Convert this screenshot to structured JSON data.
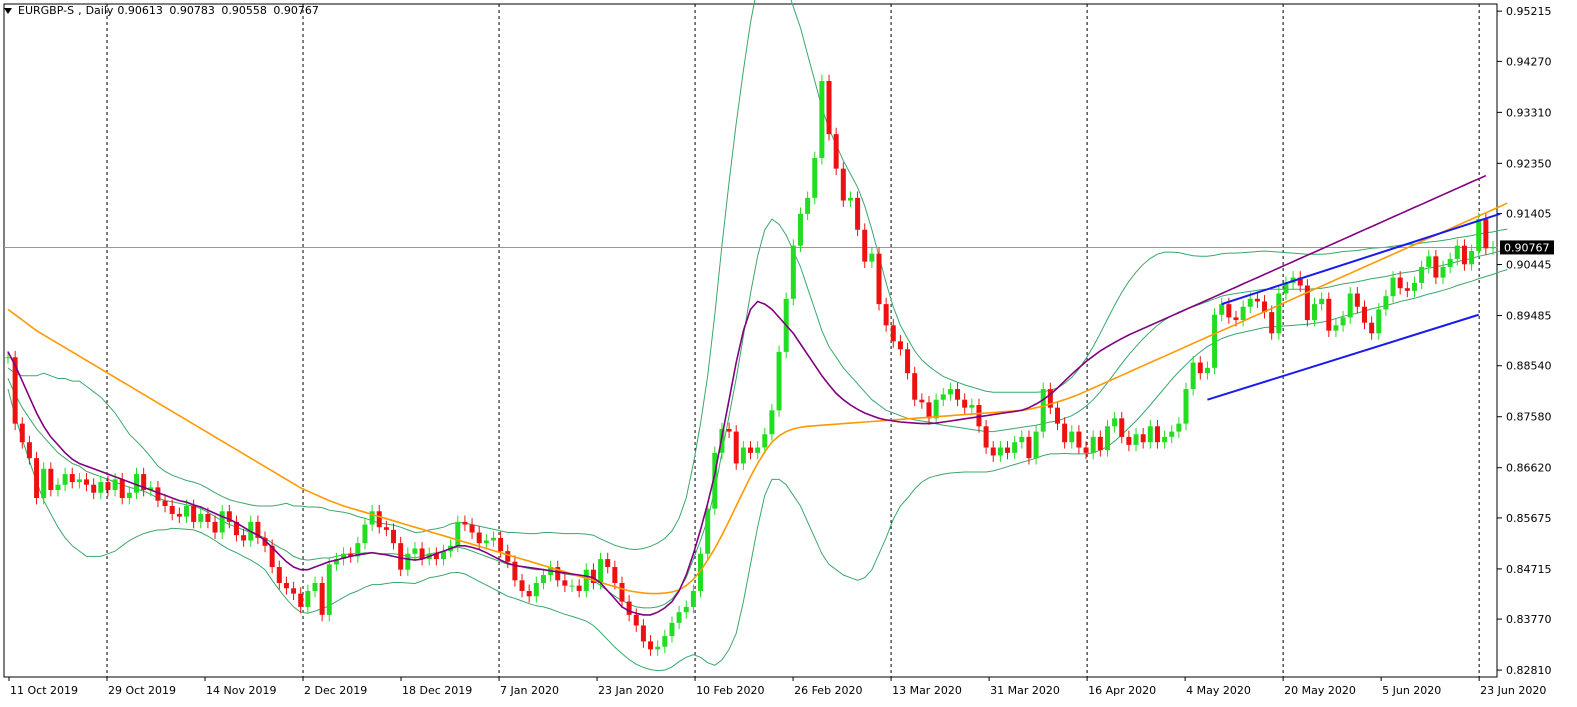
{
  "header": {
    "symbol": "EURGBP-S",
    "timeframe": "Daily",
    "open": "0.90613",
    "high": "0.90783",
    "low": "0.90558",
    "close": "0.90767"
  },
  "current_price_label": "0.90767",
  "colors": {
    "bull_candle": "#22dd22",
    "bear_candle": "#ee1111",
    "ma_fast": "#800080",
    "ma_slow": "#ff9900",
    "bollinger": "#3aa86a",
    "channel": "#1a1aee",
    "grid_line": "#000000",
    "price_line": "#999999"
  },
  "chart_data": {
    "type": "candlestick",
    "title": "EURGBP-S,Daily",
    "yaxis_ticks": [
      "0.95215",
      "0.94270",
      "0.93310",
      "0.92350",
      "0.91405",
      "0.90445",
      "0.89485",
      "0.88540",
      "0.87580",
      "0.86620",
      "0.85675",
      "0.84715",
      "0.83770",
      "0.82810"
    ],
    "ylim": [
      0.8268,
      0.9535
    ],
    "xaxis_ticks": [
      "11 Oct 2019",
      "29 Oct 2019",
      "14 Nov 2019",
      "2 Dec 2019",
      "18 Dec 2019",
      "7 Jan 2020",
      "23 Jan 2020",
      "10 Feb 2020",
      "26 Feb 2020",
      "13 Mar 2020",
      "31 Mar 2020",
      "16 Apr 2020",
      "4 May 2020",
      "20 May 2020",
      "5 Jun 2020",
      "23 Jun 2020"
    ],
    "vertical_separators_at": [
      "29 Oct 2019",
      "2 Dec 2019",
      "7 Jan 2020",
      "10 Feb 2020",
      "13 Mar 2020",
      "16 Apr 2020",
      "20 May 2020",
      "23 Jun 2020"
    ],
    "current_price": 0.90767,
    "close_series": [
      0.887,
      0.8745,
      0.871,
      0.868,
      0.8605,
      0.866,
      0.862,
      0.863,
      0.865,
      0.8635,
      0.864,
      0.863,
      0.8615,
      0.8635,
      0.862,
      0.864,
      0.8605,
      0.8615,
      0.865,
      0.862,
      0.8625,
      0.86,
      0.859,
      0.8575,
      0.857,
      0.859,
      0.856,
      0.8575,
      0.856,
      0.854,
      0.858,
      0.856,
      0.8535,
      0.8525,
      0.856,
      0.853,
      0.8515,
      0.8475,
      0.8445,
      0.8435,
      0.8425,
      0.84,
      0.843,
      0.8445,
      0.8385,
      0.848,
      0.849,
      0.85,
      0.8495,
      0.852,
      0.8555,
      0.858,
      0.855,
      0.8545,
      0.852,
      0.847,
      0.85,
      0.851,
      0.849,
      0.85,
      0.849,
      0.8505,
      0.8515,
      0.856,
      0.8555,
      0.854,
      0.852,
      0.8525,
      0.853,
      0.8505,
      0.8485,
      0.845,
      0.843,
      0.842,
      0.8445,
      0.846,
      0.8475,
      0.845,
      0.844,
      0.844,
      0.843,
      0.847,
      0.8445,
      0.849,
      0.8475,
      0.8445,
      0.841,
      0.8385,
      0.8365,
      0.8335,
      0.832,
      0.8325,
      0.8345,
      0.837,
      0.839,
      0.84,
      0.843,
      0.85,
      0.8585,
      0.869,
      0.8735,
      0.873,
      0.867,
      0.87,
      0.869,
      0.87,
      0.8725,
      0.877,
      0.888,
      0.898,
      0.908,
      0.914,
      0.917,
      0.9245,
      0.939,
      0.929,
      0.9225,
      0.9165,
      0.917,
      0.911,
      0.905,
      0.9065,
      0.897,
      0.893,
      0.89,
      0.8885,
      0.884,
      0.879,
      0.8785,
      0.8755,
      0.879,
      0.88,
      0.881,
      0.879,
      0.8775,
      0.878,
      0.874,
      0.87,
      0.8685,
      0.87,
      0.869,
      0.871,
      0.872,
      0.868,
      0.873,
      0.881,
      0.8775,
      0.8745,
      0.871,
      0.873,
      0.87,
      0.869,
      0.872,
      0.8695,
      0.874,
      0.8755,
      0.872,
      0.8705,
      0.8725,
      0.871,
      0.874,
      0.871,
      0.872,
      0.873,
      0.8745,
      0.881,
      0.886,
      0.884,
      0.885,
      0.895,
      0.897,
      0.8945,
      0.894,
      0.8965,
      0.898,
      0.8975,
      0.8955,
      0.8915,
      0.899,
      0.901,
      0.902,
      0.9005,
      0.894,
      0.897,
      0.898,
      0.892,
      0.893,
      0.8945,
      0.899,
      0.8965,
      0.8935,
      0.8915,
      0.896,
      0.8985,
      0.902,
      0.9,
      0.8995,
      0.901,
      0.904,
      0.906,
      0.902,
      0.904,
      0.9055,
      0.908,
      0.9045,
      0.907,
      0.913,
      0.9075,
      0.9077
    ],
    "bollinger_mid": [
      0.883,
      0.88,
      0.8775,
      0.8755,
      0.8735,
      0.872,
      0.8705,
      0.869,
      0.868,
      0.867,
      0.8665,
      0.8655,
      0.865,
      0.8645,
      0.864,
      0.8635,
      0.863,
      0.8625,
      0.8622,
      0.8618,
      0.8612,
      0.8605,
      0.86,
      0.8598,
      0.8595,
      0.8592,
      0.859,
      0.8585,
      0.8578,
      0.857,
      0.8562,
      0.8555,
      0.855,
      0.8545,
      0.854,
      0.8535,
      0.853,
      0.852,
      0.8512,
      0.8505,
      0.8495,
      0.849,
      0.8488,
      0.849,
      0.8492,
      0.8492,
      0.8495,
      0.8498,
      0.85,
      0.85,
      0.8502,
      0.8502,
      0.85,
      0.85,
      0.85,
      0.8498,
      0.8495,
      0.8492,
      0.8495,
      0.85,
      0.8502,
      0.8505,
      0.851,
      0.8512,
      0.851,
      0.8505,
      0.85,
      0.8495,
      0.849,
      0.8485,
      0.848,
      0.8478,
      0.8475,
      0.8472,
      0.847,
      0.847,
      0.8468,
      0.8465,
      0.8462,
      0.846,
      0.8458,
      0.8455,
      0.845,
      0.844,
      0.843,
      0.842,
      0.8412,
      0.8405,
      0.84,
      0.8398,
      0.8398,
      0.84,
      0.8405,
      0.8415,
      0.8432,
      0.8455,
      0.849,
      0.8525,
      0.8565,
      0.862,
      0.869,
      0.876,
      0.883,
      0.891,
      0.899,
      0.906,
      0.911,
      0.913,
      0.912,
      0.91,
      0.907,
      0.904,
      0.9,
      0.896,
      0.892,
      0.889,
      0.887,
      0.885,
      0.8835,
      0.882,
      0.8805,
      0.879,
      0.878,
      0.877,
      0.8765,
      0.876,
      0.8755,
      0.8752,
      0.875,
      0.8748,
      0.8745,
      0.8742,
      0.874,
      0.8738,
      0.8736,
      0.8734,
      0.8732,
      0.873,
      0.873,
      0.8732,
      0.8734,
      0.8736,
      0.8738,
      0.874,
      0.8742,
      0.8745,
      0.8748,
      0.875,
      0.8755,
      0.876,
      0.8768,
      0.8778,
      0.879,
      0.8805,
      0.8822,
      0.884,
      0.8858,
      0.8875,
      0.889,
      0.8905,
      0.8918,
      0.893,
      0.894,
      0.8948,
      0.8955,
      0.896,
      0.8965,
      0.897,
      0.8975,
      0.898,
      0.8985,
      0.8988,
      0.899,
      0.8992,
      0.8994,
      0.8996,
      0.8998,
      0.8998,
      0.8998,
      0.8998,
      0.8998,
      0.8998,
      0.8998,
      0.8999,
      0.9,
      0.9002,
      0.9005,
      0.9008,
      0.901,
      0.9012,
      0.9015,
      0.9018,
      0.902,
      0.9022,
      0.9025,
      0.9028,
      0.903,
      0.9032,
      0.9035,
      0.9038,
      0.904,
      0.9043,
      0.9046,
      0.905,
      0.9053,
      0.9056,
      0.906,
      0.9063,
      0.9066,
      0.907,
      0.9073,
      0.9076,
      0.908
    ],
    "bollinger_width": [
      0.002,
      0.004,
      0.006,
      0.008,
      0.01,
      0.012,
      0.013,
      0.014,
      0.015,
      0.0155,
      0.016,
      0.016,
      0.0155,
      0.015,
      0.014,
      0.013,
      0.0115,
      0.01,
      0.009,
      0.008,
      0.007,
      0.006,
      0.0055,
      0.005,
      0.0048,
      0.0046,
      0.0045,
      0.0045,
      0.0045,
      0.0045,
      0.0046,
      0.0047,
      0.0048,
      0.005,
      0.0052,
      0.0055,
      0.006,
      0.007,
      0.008,
      0.009,
      0.0095,
      0.01,
      0.01,
      0.0098,
      0.0095,
      0.009,
      0.0085,
      0.008,
      0.0075,
      0.007,
      0.0065,
      0.006,
      0.0058,
      0.0056,
      0.0054,
      0.0052,
      0.005,
      0.0048,
      0.0046,
      0.0045,
      0.0045,
      0.0045,
      0.0046,
      0.0047,
      0.0048,
      0.005,
      0.0052,
      0.0054,
      0.0056,
      0.0058,
      0.006,
      0.0062,
      0.0064,
      0.0066,
      0.0068,
      0.007,
      0.0072,
      0.0074,
      0.0076,
      0.0078,
      0.008,
      0.0082,
      0.0085,
      0.0088,
      0.0092,
      0.0096,
      0.01,
      0.0104,
      0.0108,
      0.0112,
      0.0116,
      0.012,
      0.0124,
      0.0128,
      0.0135,
      0.015,
      0.018,
      0.022,
      0.027,
      0.033,
      0.039,
      0.044,
      0.048,
      0.05,
      0.051,
      0.051,
      0.05,
      0.049,
      0.048,
      0.047,
      0.046,
      0.045,
      0.044,
      0.043,
      0.042,
      0.041,
      0.04,
      0.039,
      0.038,
      0.037,
      0.035,
      0.032,
      0.028,
      0.024,
      0.02,
      0.017,
      0.015,
      0.013,
      0.0115,
      0.0105,
      0.0098,
      0.0092,
      0.0088,
      0.0085,
      0.0082,
      0.008,
      0.0078,
      0.0076,
      0.0074,
      0.0072,
      0.007,
      0.0068,
      0.0066,
      0.0064,
      0.0062,
      0.006,
      0.006,
      0.0062,
      0.0066,
      0.0072,
      0.008,
      0.009,
      0.01,
      0.011,
      0.012,
      0.0128,
      0.0134,
      0.0138,
      0.014,
      0.014,
      0.0138,
      0.0134,
      0.0128,
      0.012,
      0.0112,
      0.0104,
      0.0096,
      0.009,
      0.0085,
      0.0082,
      0.008,
      0.0078,
      0.0076,
      0.0075,
      0.0074,
      0.0073,
      0.0072,
      0.0071,
      0.007,
      0.0069,
      0.0068,
      0.0067,
      0.0066,
      0.0065,
      0.0064,
      0.0063,
      0.0062,
      0.0061,
      0.006,
      0.0059,
      0.0058,
      0.0057,
      0.0056,
      0.0055,
      0.0054,
      0.0053,
      0.0052,
      0.0051,
      0.005,
      0.0049,
      0.0048,
      0.0047,
      0.0046,
      0.0045,
      0.0044,
      0.0043,
      0.0042,
      0.0041,
      0.004,
      0.0039,
      0.0038
    ],
    "ma_fast": [
      0.888,
      0.8855,
      0.8825,
      0.8795,
      0.8765,
      0.874,
      0.872,
      0.8705,
      0.869,
      0.8678,
      0.867,
      0.8665,
      0.866,
      0.8655,
      0.865,
      0.8645,
      0.864,
      0.8635,
      0.863,
      0.8625,
      0.862,
      0.8615,
      0.861,
      0.8605,
      0.86,
      0.8597,
      0.8592,
      0.8588,
      0.8582,
      0.8576,
      0.857,
      0.8565,
      0.8558,
      0.855,
      0.8542,
      0.8535,
      0.8525,
      0.8512,
      0.8498,
      0.8485,
      0.8475,
      0.847,
      0.847,
      0.8475,
      0.848,
      0.8485,
      0.8488,
      0.8492,
      0.8495,
      0.8498,
      0.85,
      0.8502,
      0.85,
      0.8498,
      0.8495,
      0.8492,
      0.849,
      0.8488,
      0.849,
      0.8495,
      0.85,
      0.8505,
      0.851,
      0.8515,
      0.8515,
      0.8512,
      0.8508,
      0.8502,
      0.8495,
      0.8488,
      0.8482,
      0.8478,
      0.8476,
      0.8474,
      0.8472,
      0.847,
      0.8468,
      0.8466,
      0.8464,
      0.8462,
      0.846,
      0.8458,
      0.8455,
      0.8445,
      0.843,
      0.8415,
      0.84,
      0.8392,
      0.8388,
      0.8385,
      0.8385,
      0.839,
      0.8398,
      0.841,
      0.843,
      0.846,
      0.85,
      0.8545,
      0.8595,
      0.865,
      0.872,
      0.879,
      0.886,
      0.892,
      0.896,
      0.8975,
      0.897,
      0.896,
      0.8945,
      0.893,
      0.8915,
      0.8895,
      0.8875,
      0.8855,
      0.8835,
      0.8818,
      0.8802,
      0.879,
      0.878,
      0.8772,
      0.8765,
      0.876,
      0.8755,
      0.8752,
      0.875,
      0.8748,
      0.8747,
      0.8746,
      0.8745,
      0.8745,
      0.8746,
      0.8748,
      0.875,
      0.8752,
      0.8754,
      0.8756,
      0.8758,
      0.876,
      0.8762,
      0.8764,
      0.8766,
      0.8768,
      0.877,
      0.8775,
      0.8782,
      0.879,
      0.88,
      0.8812,
      0.8825,
      0.8838,
      0.885,
      0.8862,
      0.8872,
      0.8882,
      0.889,
      0.8898,
      0.8905,
      0.8912,
      0.8918,
      0.8924,
      0.893,
      0.8936,
      0.8942,
      0.8948,
      0.8954,
      0.896,
      0.8966,
      0.8972,
      0.8978,
      0.8984,
      0.899,
      0.8996,
      0.9002,
      0.9008,
      0.9014,
      0.902,
      0.9026,
      0.9032,
      0.9038,
      0.9044,
      0.905,
      0.9056,
      0.9062,
      0.9068,
      0.9074,
      0.908,
      0.9086,
      0.9092,
      0.9098,
      0.9104,
      0.911,
      0.9116,
      0.9122,
      0.9128,
      0.9134,
      0.914,
      0.9146,
      0.9152,
      0.9158,
      0.9164,
      0.917,
      0.9176,
      0.9182,
      0.9188,
      0.9194,
      0.92,
      0.9206,
      0.9212
    ],
    "ma_slow": [
      0.896,
      0.895,
      0.894,
      0.893,
      0.892,
      0.8912,
      0.8904,
      0.8896,
      0.8888,
      0.888,
      0.8872,
      0.8864,
      0.8856,
      0.8848,
      0.884,
      0.8832,
      0.8824,
      0.8816,
      0.8808,
      0.88,
      0.8792,
      0.8784,
      0.8776,
      0.8768,
      0.876,
      0.8752,
      0.8744,
      0.8736,
      0.8728,
      0.872,
      0.8712,
      0.8704,
      0.8696,
      0.8688,
      0.868,
      0.8672,
      0.8664,
      0.8656,
      0.8648,
      0.864,
      0.8632,
      0.8624,
      0.8618,
      0.8612,
      0.8606,
      0.86,
      0.8595,
      0.859,
      0.8586,
      0.8582,
      0.8578,
      0.8574,
      0.857,
      0.8566,
      0.8562,
      0.8558,
      0.8554,
      0.855,
      0.8546,
      0.8542,
      0.8538,
      0.8534,
      0.853,
      0.8526,
      0.8522,
      0.8518,
      0.8514,
      0.851,
      0.8506,
      0.8502,
      0.8498,
      0.8494,
      0.849,
      0.8486,
      0.8482,
      0.8478,
      0.8474,
      0.847,
      0.8466,
      0.8462,
      0.8458,
      0.8454,
      0.845,
      0.8446,
      0.8442,
      0.8438,
      0.8434,
      0.843,
      0.8428,
      0.8426,
      0.8425,
      0.8425,
      0.8426,
      0.8428,
      0.8432,
      0.844,
      0.8452,
      0.8468,
      0.8488,
      0.851,
      0.8535,
      0.8562,
      0.859,
      0.8618,
      0.8645,
      0.867,
      0.8692,
      0.871,
      0.8722,
      0.873,
      0.8735,
      0.8738,
      0.874,
      0.8741,
      0.8742,
      0.8743,
      0.8744,
      0.8745,
      0.8746,
      0.8747,
      0.8748,
      0.8749,
      0.875,
      0.8751,
      0.8752,
      0.8753,
      0.8754,
      0.8755,
      0.8756,
      0.8757,
      0.8758,
      0.8759,
      0.876,
      0.8761,
      0.8762,
      0.8763,
      0.8764,
      0.8765,
      0.8766,
      0.8767,
      0.8768,
      0.8769,
      0.877,
      0.8772,
      0.8775,
      0.8778,
      0.8782,
      0.8786,
      0.879,
      0.8795,
      0.88,
      0.8806,
      0.8812,
      0.8818,
      0.8824,
      0.883,
      0.8836,
      0.8842,
      0.8848,
      0.8854,
      0.886,
      0.8866,
      0.8872,
      0.8878,
      0.8884,
      0.889,
      0.8896,
      0.8902,
      0.8908,
      0.8914,
      0.892,
      0.8926,
      0.8932,
      0.8938,
      0.8944,
      0.895,
      0.8956,
      0.8962,
      0.8968,
      0.8974,
      0.898,
      0.8986,
      0.8992,
      0.8998,
      0.9004,
      0.901,
      0.9016,
      0.9022,
      0.9028,
      0.9034,
      0.904,
      0.9046,
      0.9052,
      0.9058,
      0.9064,
      0.907,
      0.9076,
      0.9082,
      0.9088,
      0.9094,
      0.91,
      0.9106,
      0.9112,
      0.9118,
      0.9124,
      0.913,
      0.9136,
      0.9142,
      0.9148,
      0.9154,
      0.916
    ],
    "channel_upper": [
      {
        "x_index": 170,
        "y": 0.897
      },
      {
        "x_index": 209,
        "y": 0.914
      }
    ],
    "channel_lower": [
      {
        "x_index": 168,
        "y": 0.879
      },
      {
        "x_index": 206,
        "y": 0.895
      }
    ]
  }
}
